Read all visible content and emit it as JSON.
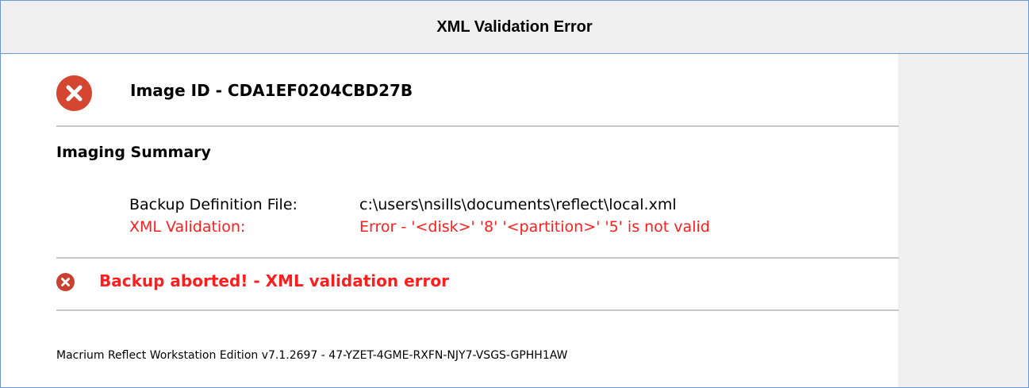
{
  "window": {
    "title": "XML Validation Error"
  },
  "report": {
    "image_id": "Image ID - CDA1EF0204CBD27B",
    "summary_title": "Imaging Summary",
    "rows": [
      {
        "label": "Backup Definition File:",
        "value": "c:\\users\\nsills\\documents\\reflect\\local.xml",
        "color": "#000000"
      },
      {
        "label": "XML Validation:",
        "value": "Error - '<disk>' '8' '<partition>' '5' is not valid",
        "color": "#ff1e1e"
      }
    ],
    "status_message": "Backup aborted! - XML validation error",
    "footer": "Macrium Reflect Workstation Edition v7.1.2697 - 47-YZET-4GME-RXFN-NJY7-VSGS-GPHH1AW"
  },
  "icons": {
    "main_error": "error-circle-x-icon",
    "status_error": "error-circle-x-icon"
  },
  "colors": {
    "border": "#6b97cf",
    "header_bg": "#f0f0f0",
    "error_red": "#ff1e1e",
    "icon_red": "#d4462f"
  }
}
